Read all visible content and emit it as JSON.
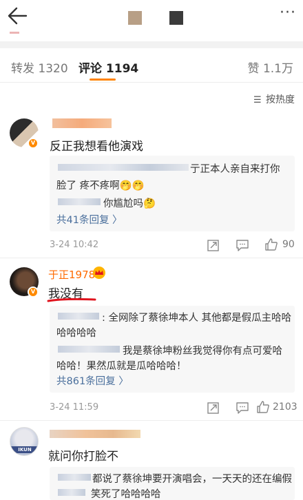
{
  "tabs": {
    "repost": "转发 1320",
    "comments": "评论 1194",
    "likes": "赞 1.1万"
  },
  "sort_label": "按热度",
  "colors": {
    "accent": "#ff8200",
    "link": "#4a6f9c",
    "underline": "#e0141e"
  },
  "comments": [
    {
      "text": "反正我想看他演戏",
      "replies": [
        "亍正本人亲自来打你",
        "脸了 疼不疼啊🤭🤭",
        "你尴尬吗🤔"
      ],
      "more": "共41条回复 〉",
      "time": "3-24 10:42",
      "likes": "90"
    },
    {
      "user": "于正1978",
      "text": "我没有",
      "replies": [
        ": 全网除了蔡徐坤本人 其他都是假瓜主哈哈",
        "哈哈哈哈",
        "我是蔡徐坤粉丝我觉得你有点可爱哈",
        "哈哈！果然瓜就是瓜哈哈哈！"
      ],
      "more": "共861条回复 〉",
      "time": "3-24 11:59",
      "likes": "2103"
    },
    {
      "avatar_text": "IKUN",
      "text": "就问你打脸不",
      "replies": [
        "都说了蔡徐坤要开演唱会，一天天的还在编假",
        "笑死了哈哈哈哈"
      ]
    }
  ]
}
